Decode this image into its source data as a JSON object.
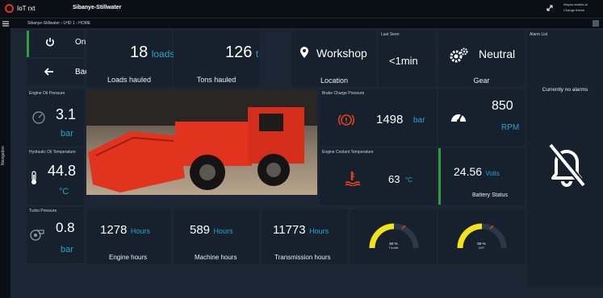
{
  "app": {
    "name": "IoT rxt",
    "site": "Sibanye-Stillwater",
    "user_line1": "Wayne.ambler.ai",
    "user_line2": "Change theme"
  },
  "breadcrumb": {
    "items": [
      "Sibanye-Stillwater",
      "LHD 1",
      "HOME"
    ]
  },
  "sidebar": {
    "label": "Navigation"
  },
  "status": {
    "online_label": "Online",
    "back_label": "Back"
  },
  "loads": {
    "value": "18",
    "unit": "loads",
    "label": "Loads hauled"
  },
  "tons": {
    "value": "126",
    "unit": "t",
    "label": "Tons hauled"
  },
  "location": {
    "value": "Workshop",
    "label": "Location"
  },
  "last_seen": {
    "title": "Last Seen",
    "value": "<1min"
  },
  "gear": {
    "value": "Neutral",
    "label": "Gear"
  },
  "alarms": {
    "title": "Alarm List",
    "message": "Currently no alarms"
  },
  "engine_oil": {
    "title": "Engine Oil Pressure",
    "value": "3.1",
    "unit": "bar"
  },
  "hydraulic_oil": {
    "title": "Hydraulic Oil Temperature",
    "value": "44.8",
    "unit": "°C"
  },
  "turbo": {
    "title": "Turbo Pressure",
    "value": "0.8",
    "unit": "bar"
  },
  "brake": {
    "title": "Brake Charge Pressure",
    "value": "1498",
    "unit": "bar"
  },
  "rpm": {
    "value": "850",
    "unit": "RPM"
  },
  "coolant": {
    "title": "Engine Coolant Temperature",
    "value": "63",
    "unit": "°C"
  },
  "battery": {
    "value": "24.56",
    "unit": "Volts",
    "label": "Battery Status"
  },
  "engine_hours": {
    "value": "1278",
    "unit": "Hours",
    "label": "Engine hours"
  },
  "machine_hours": {
    "value": "589",
    "unit": "Hours",
    "label": "Machine hours"
  },
  "transmission_hours": {
    "value": "11773",
    "unit": "Hours",
    "label": "Transmission hours"
  },
  "gauges": [
    {
      "value_text": "50 %",
      "label": "Throttle",
      "level": 0.5
    },
    {
      "value_text": "50 %",
      "label": "DEF",
      "level": 0.5
    }
  ],
  "colors": {
    "accent": "#2aa3c9",
    "online": "#2e9e3e",
    "alarm_red": "#e0421f",
    "gauge_yellow": "#f2e21b",
    "loader_red": "#e2331e"
  },
  "icons": {
    "power": "power-icon",
    "back": "arrow-left-icon",
    "location": "map-pin-icon",
    "gear": "gears-icon",
    "bell_off": "bell-off-icon",
    "oil": "oil-gauge-icon",
    "thermo": "thermometer-icon",
    "turbo": "turbo-icon",
    "brake": "brake-warning-icon",
    "speedo": "speedometer-icon",
    "coolant": "coolant-temp-icon"
  }
}
